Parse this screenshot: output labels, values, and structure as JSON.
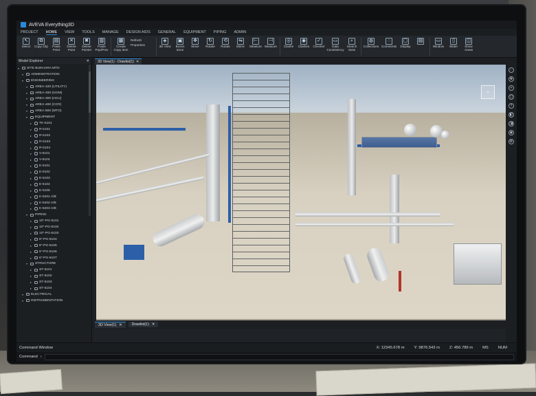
{
  "app": {
    "title": "AVEVA Everything3D"
  },
  "menu_tabs": [
    "PROJECT",
    "HOME",
    "VIEW",
    "TOOLS",
    "MANAGE",
    "DESIGN AIDS",
    "GENERAL",
    "EQUIPMENT",
    "PIPING",
    "ADMIN"
  ],
  "active_menu_tab": "HOME",
  "ribbon": {
    "select": "Select",
    "copy": "Copy Clip",
    "paste": "Paste Point",
    "delete_point": "Delete Point",
    "delete": "Delete Pointer",
    "paste2": "Paste Pop/Prev",
    "create": "Create Copy Item",
    "refresh": "Refresh",
    "properties": "Properties",
    "view3d": "3D View",
    "boxes": "Boxes Zone",
    "move": "Move",
    "rotate": "Rotate",
    "rotate2": "Rotate",
    "mirror": "Mirror",
    "measure": "Measure",
    "measure2": "Measure",
    "clashe": "Clashe",
    "clashes": "Clashes",
    "checker": "Checker",
    "data_consistency": "Data Consistency",
    "search": "Search Sess",
    "collections": "Collections",
    "comments": "Comments",
    "display": "Display",
    "window": "Window",
    "wider": "Wider",
    "show": "Show Areas"
  },
  "explorer": {
    "title": "Model Explorer",
    "items": [
      {
        "label": "SITE BUKHARA MTO",
        "level": 0,
        "type": "site"
      },
      {
        "label": "ADMINISTRATION",
        "level": 1,
        "type": "folder"
      },
      {
        "label": "ENGINEERING",
        "level": 1,
        "type": "folder"
      },
      {
        "label": "AREA-100 (UTILITY)",
        "level": 2,
        "type": "folder"
      },
      {
        "label": "AREA-200 (GOM)",
        "level": 2,
        "type": "folder"
      },
      {
        "label": "AREA-300 (HCU)",
        "level": 2,
        "type": "folder"
      },
      {
        "label": "AREA-400 (CCR)",
        "level": 2,
        "type": "folder"
      },
      {
        "label": "AREA-500 (MTO)",
        "level": 2,
        "type": "folder"
      },
      {
        "label": "EQUIPMENT",
        "level": 2,
        "type": "folder"
      },
      {
        "label": "TK-5101",
        "level": 3,
        "type": "equip"
      },
      {
        "label": "R-5101",
        "level": 3,
        "type": "equip"
      },
      {
        "label": "R-5102",
        "level": 3,
        "type": "equip"
      },
      {
        "label": "R-5103",
        "level": 3,
        "type": "equip"
      },
      {
        "label": "R-5104",
        "level": 3,
        "type": "equip"
      },
      {
        "label": "V-5101",
        "level": 3,
        "type": "equip"
      },
      {
        "label": "V-5102",
        "level": 3,
        "type": "equip"
      },
      {
        "label": "E-5101",
        "level": 3,
        "type": "equip"
      },
      {
        "label": "E-5102",
        "level": 3,
        "type": "equip"
      },
      {
        "label": "E-5103",
        "level": 3,
        "type": "equip"
      },
      {
        "label": "E-5104",
        "level": 3,
        "type": "equip"
      },
      {
        "label": "E-5105",
        "level": 3,
        "type": "equip"
      },
      {
        "label": "K-5201 A/B",
        "level": 3,
        "type": "equip"
      },
      {
        "label": "K-5202 A/B",
        "level": 3,
        "type": "equip"
      },
      {
        "label": "K-5203 A/B",
        "level": 3,
        "type": "equip"
      },
      {
        "label": "PIPING",
        "level": 2,
        "type": "folder"
      },
      {
        "label": "10\"-PG-5101",
        "level": 3,
        "type": "pipe"
      },
      {
        "label": "10\"-PG-5102",
        "level": 3,
        "type": "pipe"
      },
      {
        "label": "10\"-PG-5103",
        "level": 3,
        "type": "pipe"
      },
      {
        "label": "8\"-PG-5104",
        "level": 3,
        "type": "pipe"
      },
      {
        "label": "8\"-PG-5105",
        "level": 3,
        "type": "pipe"
      },
      {
        "label": "6\"-PG-5106",
        "level": 3,
        "type": "pipe"
      },
      {
        "label": "6\"-PG-5107",
        "level": 3,
        "type": "pipe"
      },
      {
        "label": "STRUCTURE",
        "level": 2,
        "type": "folder"
      },
      {
        "label": "ST-5101",
        "level": 3,
        "type": "pipe"
      },
      {
        "label": "ST-5102",
        "level": 3,
        "type": "pipe"
      },
      {
        "label": "ST-5103",
        "level": 3,
        "type": "pipe"
      },
      {
        "label": "ST-5104",
        "level": 3,
        "type": "pipe"
      },
      {
        "label": "ELECTRICAL",
        "level": 1,
        "type": "folder"
      },
      {
        "label": "INSTRUMENTATION",
        "level": 1,
        "type": "folder"
      }
    ]
  },
  "view_tabs": [
    "3D View(1) - Drawlist(1)"
  ],
  "bottom_tabs": [
    "3D View(1)",
    "Drawlist(1)"
  ],
  "command_window": "Command Window",
  "command_label": "Command",
  "coords": {
    "x": "X: 12345.678 m",
    "y": "Y: 9876.543 m",
    "z": "Z: 456.789 m"
  },
  "status": {
    "units": "MS",
    "num": "NUM"
  }
}
